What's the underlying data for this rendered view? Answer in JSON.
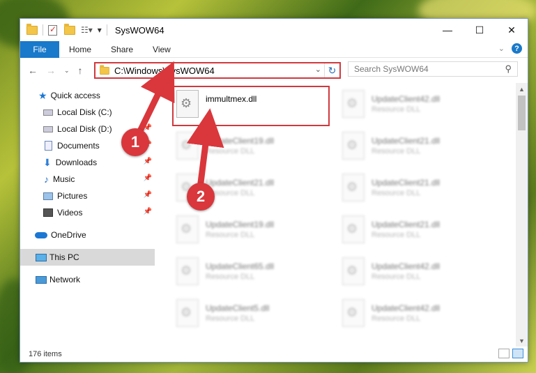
{
  "window": {
    "title": "SysWOW64",
    "buttons": {
      "minimize": "—",
      "maximize": "☐",
      "close": "✕"
    }
  },
  "ribbon": {
    "tabs": [
      "File",
      "Home",
      "Share",
      "View"
    ],
    "help": "?"
  },
  "address": {
    "path": "C:\\Windows\\SysWOW64",
    "search_placeholder": "Search SysWOW64"
  },
  "nav_pane": {
    "items": [
      {
        "label": "Quick access",
        "icon": "star-icon"
      },
      {
        "label": "Local Disk (C:)",
        "icon": "disk-icon"
      },
      {
        "label": "Local Disk (D:)",
        "icon": "disk-icon"
      },
      {
        "label": "Documents",
        "icon": "documents-icon"
      },
      {
        "label": "Downloads",
        "icon": "downloads-icon"
      },
      {
        "label": "Music",
        "icon": "music-icon"
      },
      {
        "label": "Pictures",
        "icon": "pictures-icon"
      },
      {
        "label": "Videos",
        "icon": "videos-icon"
      },
      {
        "label": "OneDrive",
        "icon": "cloud-icon"
      },
      {
        "label": "This PC",
        "icon": "pc-icon"
      },
      {
        "label": "Network",
        "icon": "network-icon"
      }
    ]
  },
  "files": [
    {
      "name": "immultmex.dll",
      "type": ""
    },
    {
      "name": "UpdateClient42.dll",
      "type": "Resource DLL"
    },
    {
      "name": "UpdateClient19.dll",
      "type": "Resource DLL"
    },
    {
      "name": "UpdateClient21.dll",
      "type": "Resource DLL"
    },
    {
      "name": "UpdateClient21.dll",
      "type": "Resource DLL"
    },
    {
      "name": "UpdateClient21.dll",
      "type": "Resource DLL"
    },
    {
      "name": "UpdateClient19.dll",
      "type": "Resource DLL"
    },
    {
      "name": "UpdateClient21.dll",
      "type": "Resource DLL"
    },
    {
      "name": "UpdateClient65.dll",
      "type": "Resource DLL"
    },
    {
      "name": "UpdateClient42.dll",
      "type": "Resource DLL"
    },
    {
      "name": "UpdateClient5.dll",
      "type": "Resource DLL"
    },
    {
      "name": "UpdateClient42.dll",
      "type": "Resource DLL"
    }
  ],
  "status": {
    "item_count": "176 items"
  },
  "callouts": {
    "one": "1",
    "two": "2"
  },
  "colors": {
    "accent": "#1979ca",
    "callout": "#d9373c"
  }
}
